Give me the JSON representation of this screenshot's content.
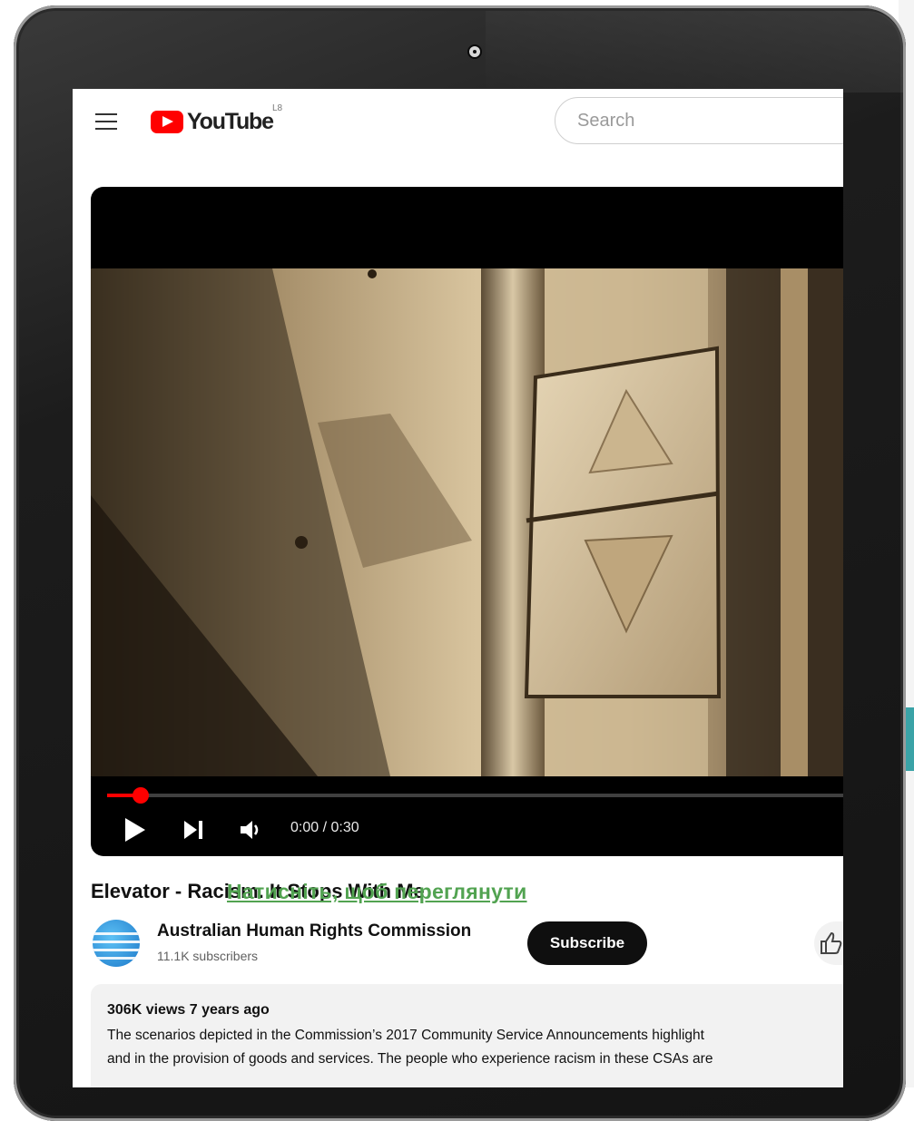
{
  "header": {
    "logo_text": "YouTube",
    "logo_sup": "L8",
    "search_placeholder": "Search"
  },
  "player": {
    "current_time": "0:00",
    "duration": "0:30",
    "time_display": "0:00 / 0:30",
    "progress_fraction": 0.02
  },
  "video": {
    "title": "Elevator - Racism. It Stops With Me",
    "overlay_link": "Натисніть, щоб переглянути",
    "channel_name": "Australian Human Rights Commission",
    "subscribers": "11.1K subscribers",
    "subscribe_label": "Subscribe",
    "views_and_age": "306K views  7 years ago",
    "description_line1": "The scenarios depicted in the Commission’s 2017 Community Service Announcements highlight",
    "description_line2": "and in the provision of goods and services. The people who experience racism in these CSAs are"
  },
  "colors": {
    "brand_red": "#ff0000",
    "link_green": "#52a351",
    "tablet_frame": "#1c1c1c",
    "accent_teal": "#3aa3a7"
  },
  "icons": [
    "menu-icon",
    "youtube-logo-icon",
    "play-icon",
    "next-icon",
    "volume-icon",
    "like-icon",
    "camera-icon"
  ]
}
